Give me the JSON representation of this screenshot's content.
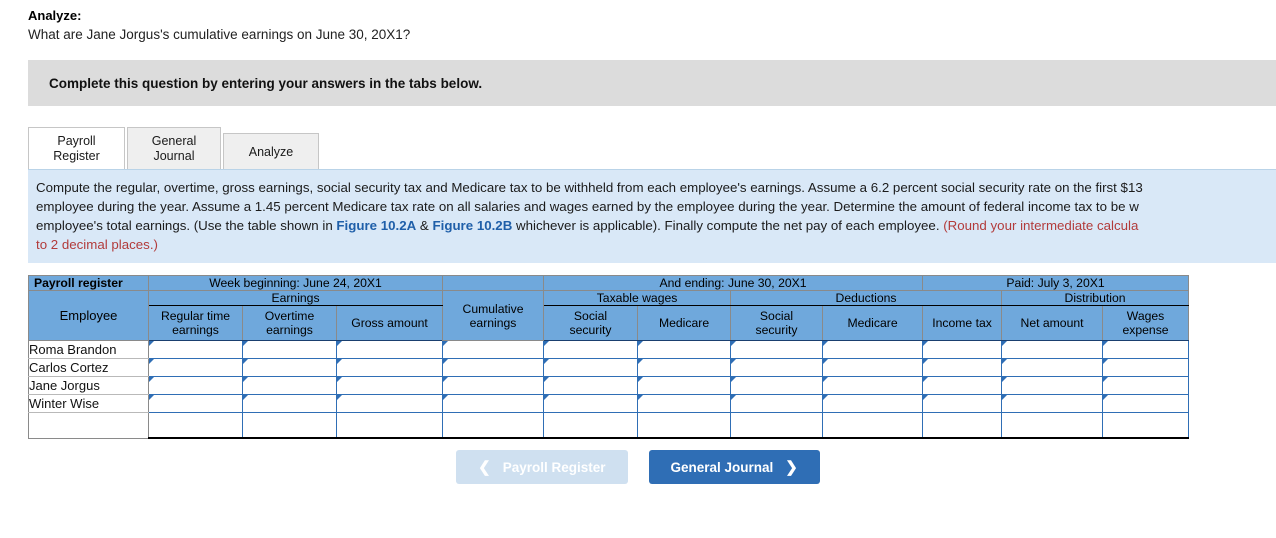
{
  "question": {
    "label": "Analyze:",
    "text": "What are Jane Jorgus's cumulative earnings on June 30, 20X1?"
  },
  "banner": {
    "text": "Complete this question by entering your answers in the tabs below."
  },
  "tabs": [
    {
      "label": "Payroll\nRegister",
      "active": true
    },
    {
      "label": "General\nJournal",
      "active": false
    },
    {
      "label": "Analyze",
      "active": false
    }
  ],
  "instructions": {
    "line1": "Compute the regular, overtime, gross earnings, social security tax and Medicare tax to be withheld from each employee's earnings. Assume a 6.2 percent social security rate on the first $13",
    "line2a": "employee during the year. Assume a 1.45 percent Medicare tax rate on all salaries and wages earned by the employee during the year. Determine the amount of federal income tax to be w",
    "line3a": "employee's total earnings. (Use the table shown in ",
    "figure_a": "Figure 10.2A",
    "amp": " & ",
    "figure_b": "Figure 10.2B",
    "line3b": " whichever is applicable). Finally compute the net pay of each employee. ",
    "round_note1": "(Round your intermediate calcula",
    "round_note2": "to 2 decimal places.)"
  },
  "table": {
    "corner_title": "Payroll register",
    "period": {
      "week_beginning": "Week beginning: June 24, 20X1",
      "and_ending": "And ending: June 30, 20X1",
      "paid": "Paid: July 3, 20X1"
    },
    "groups": {
      "earnings": "Earnings",
      "taxable_wages": "Taxable wages",
      "deductions": "Deductions",
      "distribution": "Distribution"
    },
    "columns": {
      "employee": "Employee",
      "regular_time_earnings": "Regular time\nearnings",
      "overtime_earnings": "Overtime\nearnings",
      "gross_amount": "Gross amount",
      "cumulative_earnings": "Cumulative\nearnings",
      "taxable_social_security": "Social\nsecurity",
      "taxable_medicare": "Medicare",
      "deduction_social_security": "Social\nsecurity",
      "deduction_medicare": "Medicare",
      "income_tax": "Income tax",
      "net_amount": "Net amount",
      "wages_expense": "Wages\nexpense"
    },
    "rows": [
      {
        "employee": "Roma Brandon"
      },
      {
        "employee": "Carlos Cortez"
      },
      {
        "employee": "Jane Jorgus"
      },
      {
        "employee": "Winter Wise"
      }
    ],
    "total_row": {
      "employee": ""
    }
  },
  "nav": {
    "prev_label": "Payroll Register",
    "next_label": "General Journal",
    "prev_icon": "chevron-left-icon",
    "next_icon": "chevron-right-icon"
  },
  "colors": {
    "header_blue": "#6fa8dc",
    "panel_blue": "#d9e8f7",
    "banner_gray": "#dcdcdc",
    "button_blue": "#2f6eb5",
    "button_disabled": "#cfe0f0",
    "link_blue": "#1f5fa9",
    "note_red": "#b23b3b"
  }
}
